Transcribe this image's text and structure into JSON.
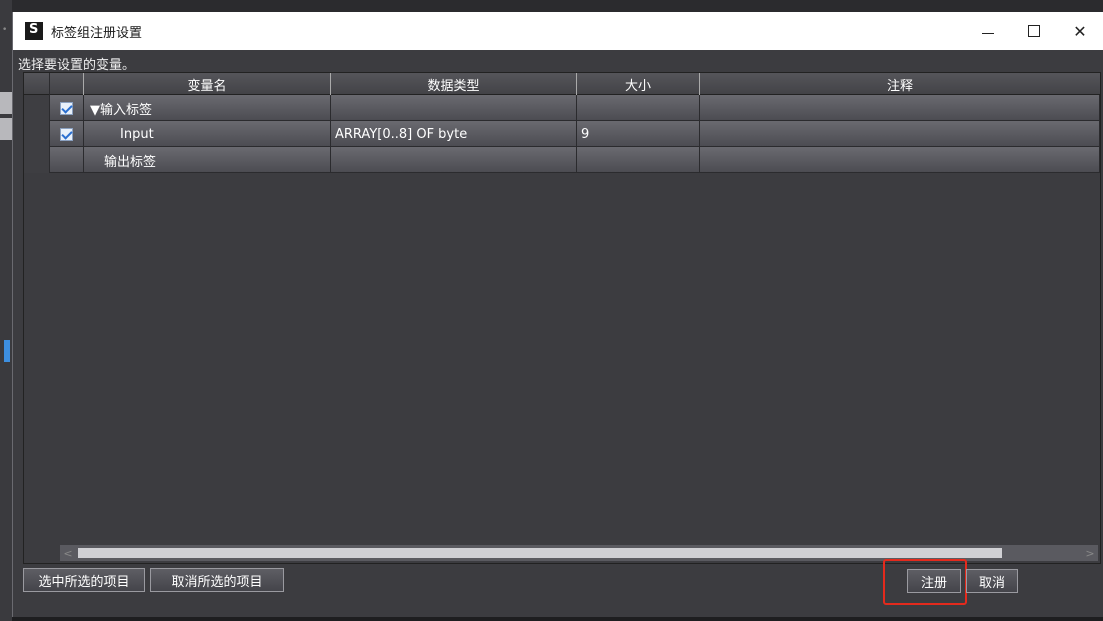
{
  "window": {
    "title": "标签组注册设置",
    "minimize_label": "—",
    "close_label": "✕"
  },
  "instruction": "选择要设置的变量。",
  "table": {
    "headers": [
      "变量名",
      "数据类型",
      "大小",
      "注释"
    ],
    "rows": [
      {
        "checked": true,
        "name": "▼输入标签",
        "type": "",
        "size": "",
        "comment": ""
      },
      {
        "checked": true,
        "name": "Input",
        "type": "ARRAY[0..8] OF byte",
        "size": "9",
        "comment": ""
      },
      {
        "checked": false,
        "name": "输出标签",
        "type": "",
        "size": "",
        "comment": ""
      }
    ]
  },
  "buttons": {
    "select_all": "选中所选的项目",
    "deselect_all": "取消所选的项目",
    "register": "注册",
    "cancel": "取消"
  },
  "colors": {
    "highlight": "#e42a1d"
  }
}
